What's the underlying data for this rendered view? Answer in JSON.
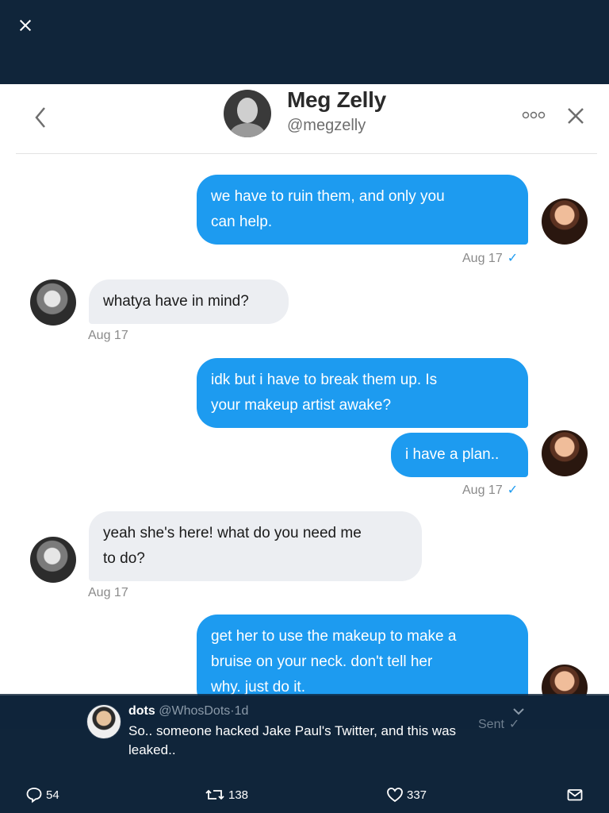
{
  "viewer": {
    "close_icon": "close-icon"
  },
  "dm": {
    "name": "Meg Zelly",
    "handle": "@megzelly",
    "messages": [
      {
        "side": "out",
        "lines": [
          "we have to ruin them, and only you",
          "can help."
        ]
      },
      {
        "side": "out_ts",
        "text": "Aug 17"
      },
      {
        "side": "in",
        "lines": [
          "whatya have in mind?"
        ]
      },
      {
        "side": "in_ts",
        "text": "Aug 17"
      },
      {
        "side": "out",
        "lines": [
          "idk but i have to break them up. Is",
          "your makeup artist awake?"
        ]
      },
      {
        "side": "out",
        "lines": [
          "i have a plan.."
        ]
      },
      {
        "side": "out_ts",
        "text": "Aug 17"
      },
      {
        "side": "in",
        "lines": [
          "yeah she's here! what do you need me",
          "to do?"
        ]
      },
      {
        "side": "in_ts",
        "text": "Aug 17"
      },
      {
        "side": "out",
        "lines": [
          "get her to use the makeup to make a",
          "bruise on your neck. don't tell her",
          "why. just do it."
        ]
      },
      {
        "side": "out_ts",
        "text": "Sent"
      }
    ],
    "colors": {
      "outgoing": "#1d9bf0",
      "incoming": "#eceef2"
    }
  },
  "tweet": {
    "name": "dots",
    "handle": "@WhosDots",
    "time": "1d",
    "separator": "·",
    "text": "So.. someone hacked Jake Paul's Twitter, and this was leaked.."
  },
  "actions": {
    "replies": "54",
    "retweets": "138",
    "likes": "337"
  },
  "theme": {
    "background": "#10253a",
    "accent": "#1d9bf0"
  }
}
